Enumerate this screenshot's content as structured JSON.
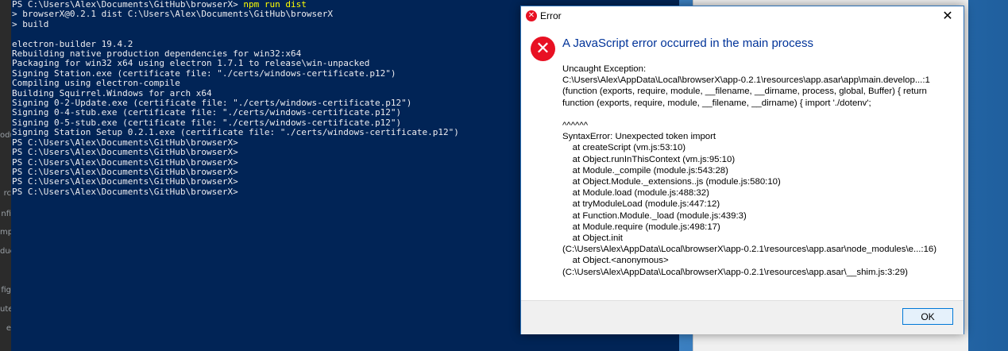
{
  "background_strip": {
    "fragments": [
      "odu",
      "rc",
      "nfi",
      "mpl",
      "duc",
      "fig",
      "ute",
      "e"
    ]
  },
  "terminal": {
    "prompt_path": "PS C:\\Users\\Alex\\Documents\\GitHub\\browserX>",
    "command": "npm run dist",
    "output": "\n> browserX@0.2.1 dist C:\\Users\\Alex\\Documents\\GitHub\\browserX\n> build\n\nelectron-builder 19.4.2\nRebuilding native production dependencies for win32:x64\nPackaging for win32 x64 using electron 1.7.1 to release\\win-unpacked\nSigning Station.exe (certificate file: \"./certs/windows-certificate.p12\")\nCompiling using electron-compile\nBuilding Squirrel.Windows for arch x64\nSigning 0-2-Update.exe (certificate file: \"./certs/windows-certificate.p12\")\nSigning 0-4-stub.exe (certificate file: \"./certs/windows-certificate.p12\")\nSigning 0-5-stub.exe (certificate file: \"./certs/windows-certificate.p12\")\nSigning Station Setup 0.2.1.exe (certificate file: \"./certs/windows-certificate.p12\")\nPS C:\\Users\\Alex\\Documents\\GitHub\\browserX>\nPS C:\\Users\\Alex\\Documents\\GitHub\\browserX>\nPS C:\\Users\\Alex\\Documents\\GitHub\\browserX>\nPS C:\\Users\\Alex\\Documents\\GitHub\\browserX>\nPS C:\\Users\\Alex\\Documents\\GitHub\\browserX>\nPS C:\\Users\\Alex\\Documents\\GitHub\\browserX>"
  },
  "dialog": {
    "title": "Error",
    "title_icon": "error-icon",
    "close_glyph": "✕",
    "error_glyph": "✕",
    "main_instruction": "A JavaScript error occurred in the main process",
    "details": "Uncaught Exception:\nC:\\Users\\Alex\\AppData\\Local\\browserX\\app-0.2.1\\resources\\app.asar\\app\\main.develop...:1\n(function (exports, require, module, __filename, __dirname, process, global, Buffer) { return\nfunction (exports, require, module, __filename, __dirname) { import './dotenv';\n\n^^^^^^\nSyntaxError: Unexpected token import\n    at createScript (vm.js:53:10)\n    at Object.runInThisContext (vm.js:95:10)\n    at Module._compile (module.js:543:28)\n    at Object.Module._extensions..js (module.js:580:10)\n    at Module.load (module.js:488:32)\n    at tryModuleLoad (module.js:447:12)\n    at Function.Module._load (module.js:439:3)\n    at Module.require (module.js:498:17)\n    at Object.init\n(C:\\Users\\Alex\\AppData\\Local\\browserX\\app-0.2.1\\resources\\app.asar\\node_modules\\e...:16)\n    at Object.<anonymous>\n(C:\\Users\\Alex\\AppData\\Local\\browserX\\app-0.2.1\\resources\\app.asar\\__shim.js:3:29)",
    "ok_label": "OK"
  },
  "colors": {
    "terminal_bg": "#012456",
    "terminal_text": "#eeedf0",
    "command_text": "#ffff00",
    "error_red": "#e81123",
    "instruction_blue": "#003399",
    "focus_blue": "#0078d7"
  }
}
